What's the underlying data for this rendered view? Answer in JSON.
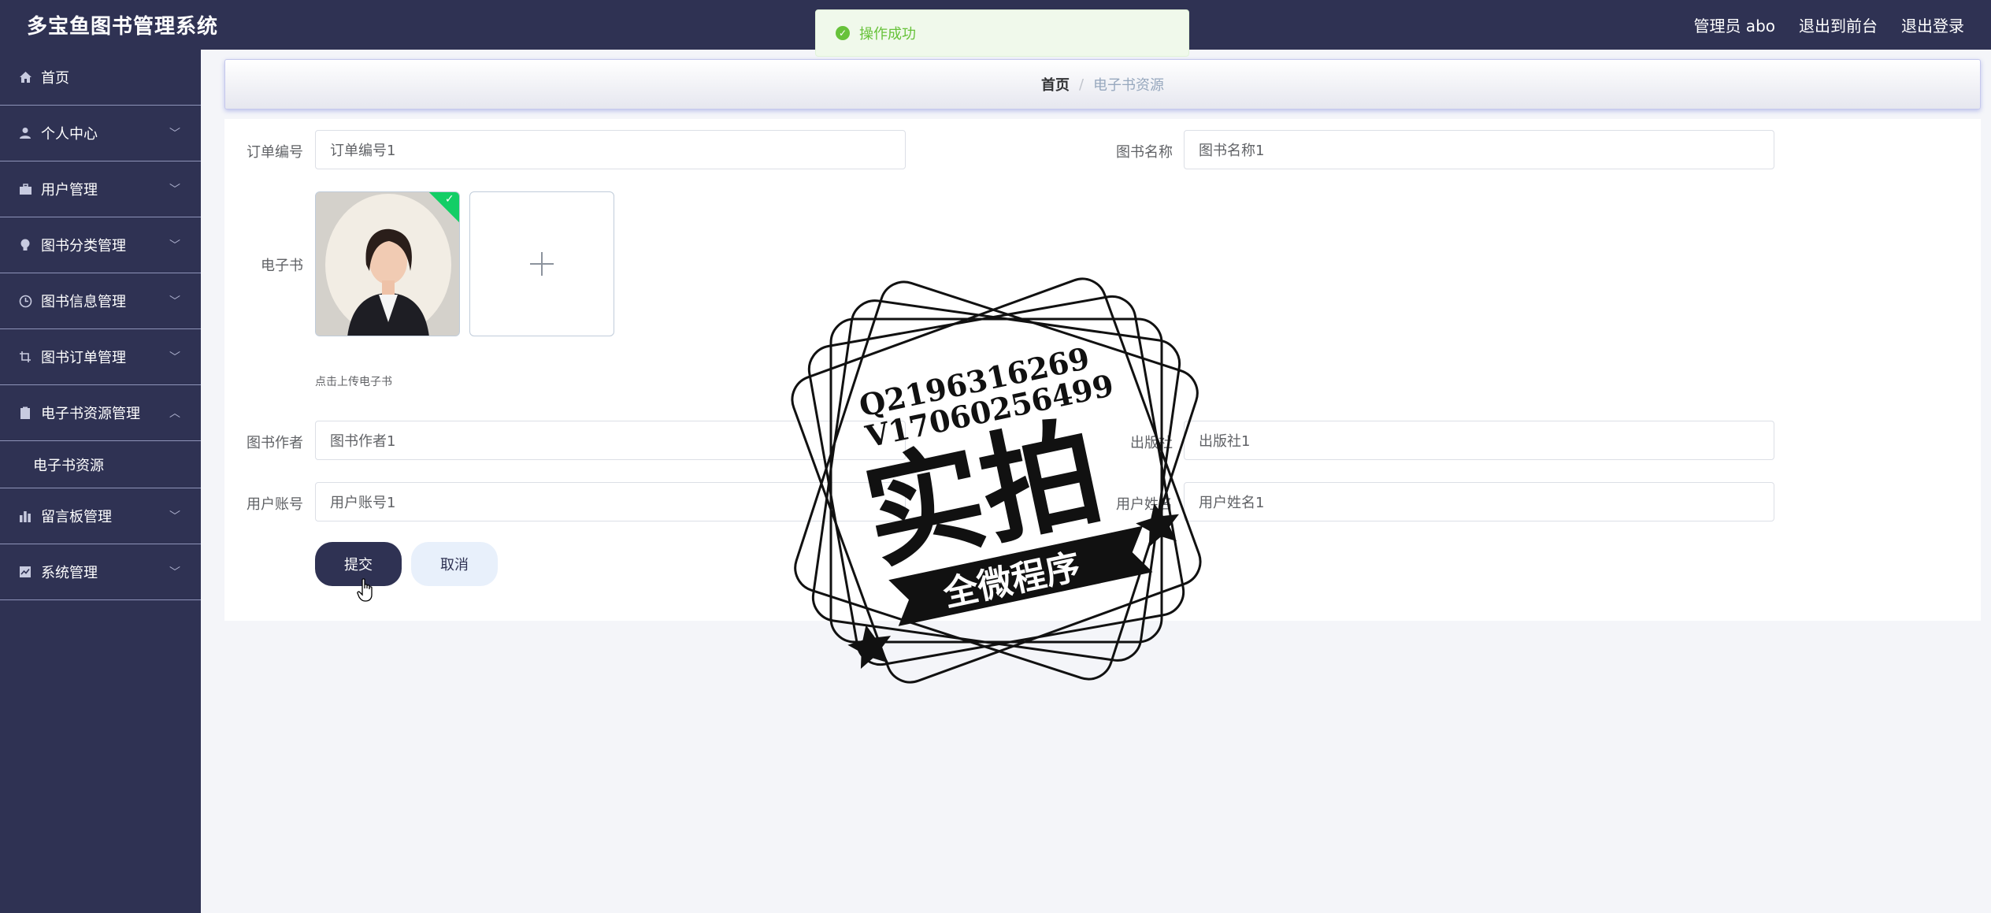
{
  "app": {
    "title": "多宝鱼图书管理系统"
  },
  "header": {
    "user": "管理员 abo",
    "front": "退出到前台",
    "logout": "退出登录"
  },
  "toast": {
    "message": "操作成功"
  },
  "sidebar": {
    "items": [
      {
        "label": "首页",
        "icon": "home-icon"
      },
      {
        "label": "个人中心",
        "icon": "user-icon"
      },
      {
        "label": "用户管理",
        "icon": "briefcase-icon"
      },
      {
        "label": "图书分类管理",
        "icon": "bulb-icon"
      },
      {
        "label": "图书信息管理",
        "icon": "clock-icon"
      },
      {
        "label": "图书订单管理",
        "icon": "crop-icon"
      },
      {
        "label": "电子书资源管理",
        "icon": "clipboard-icon"
      },
      {
        "label": "留言板管理",
        "icon": "bar-chart-icon"
      },
      {
        "label": "系统管理",
        "icon": "trend-icon"
      }
    ],
    "subitem": "电子书资源"
  },
  "breadcrumb": {
    "home": "首页",
    "sep": "/",
    "current": "电子书资源"
  },
  "form": {
    "order_no": {
      "label": "订单编号",
      "value": "订单编号1"
    },
    "book_name": {
      "label": "图书名称",
      "value": "图书名称1"
    },
    "ebook": {
      "label": "电子书",
      "tip": "点击上传电子书"
    },
    "author": {
      "label": "图书作者",
      "value": "图书作者1"
    },
    "publisher": {
      "label": "出版社",
      "value": "出版社1"
    },
    "account": {
      "label": "用户账号",
      "value": "用户账号1"
    },
    "username": {
      "label": "用户姓名",
      "value": "用户姓名1"
    },
    "submit": "提交",
    "cancel": "取消"
  },
  "watermark": {
    "line1": "Q2196316269",
    "line2": "V17060256499",
    "main": "实拍",
    "banner": "全微程序"
  },
  "colors": {
    "nav": "#2f3253",
    "success": "#67c23a",
    "accent": "#13ce66"
  }
}
